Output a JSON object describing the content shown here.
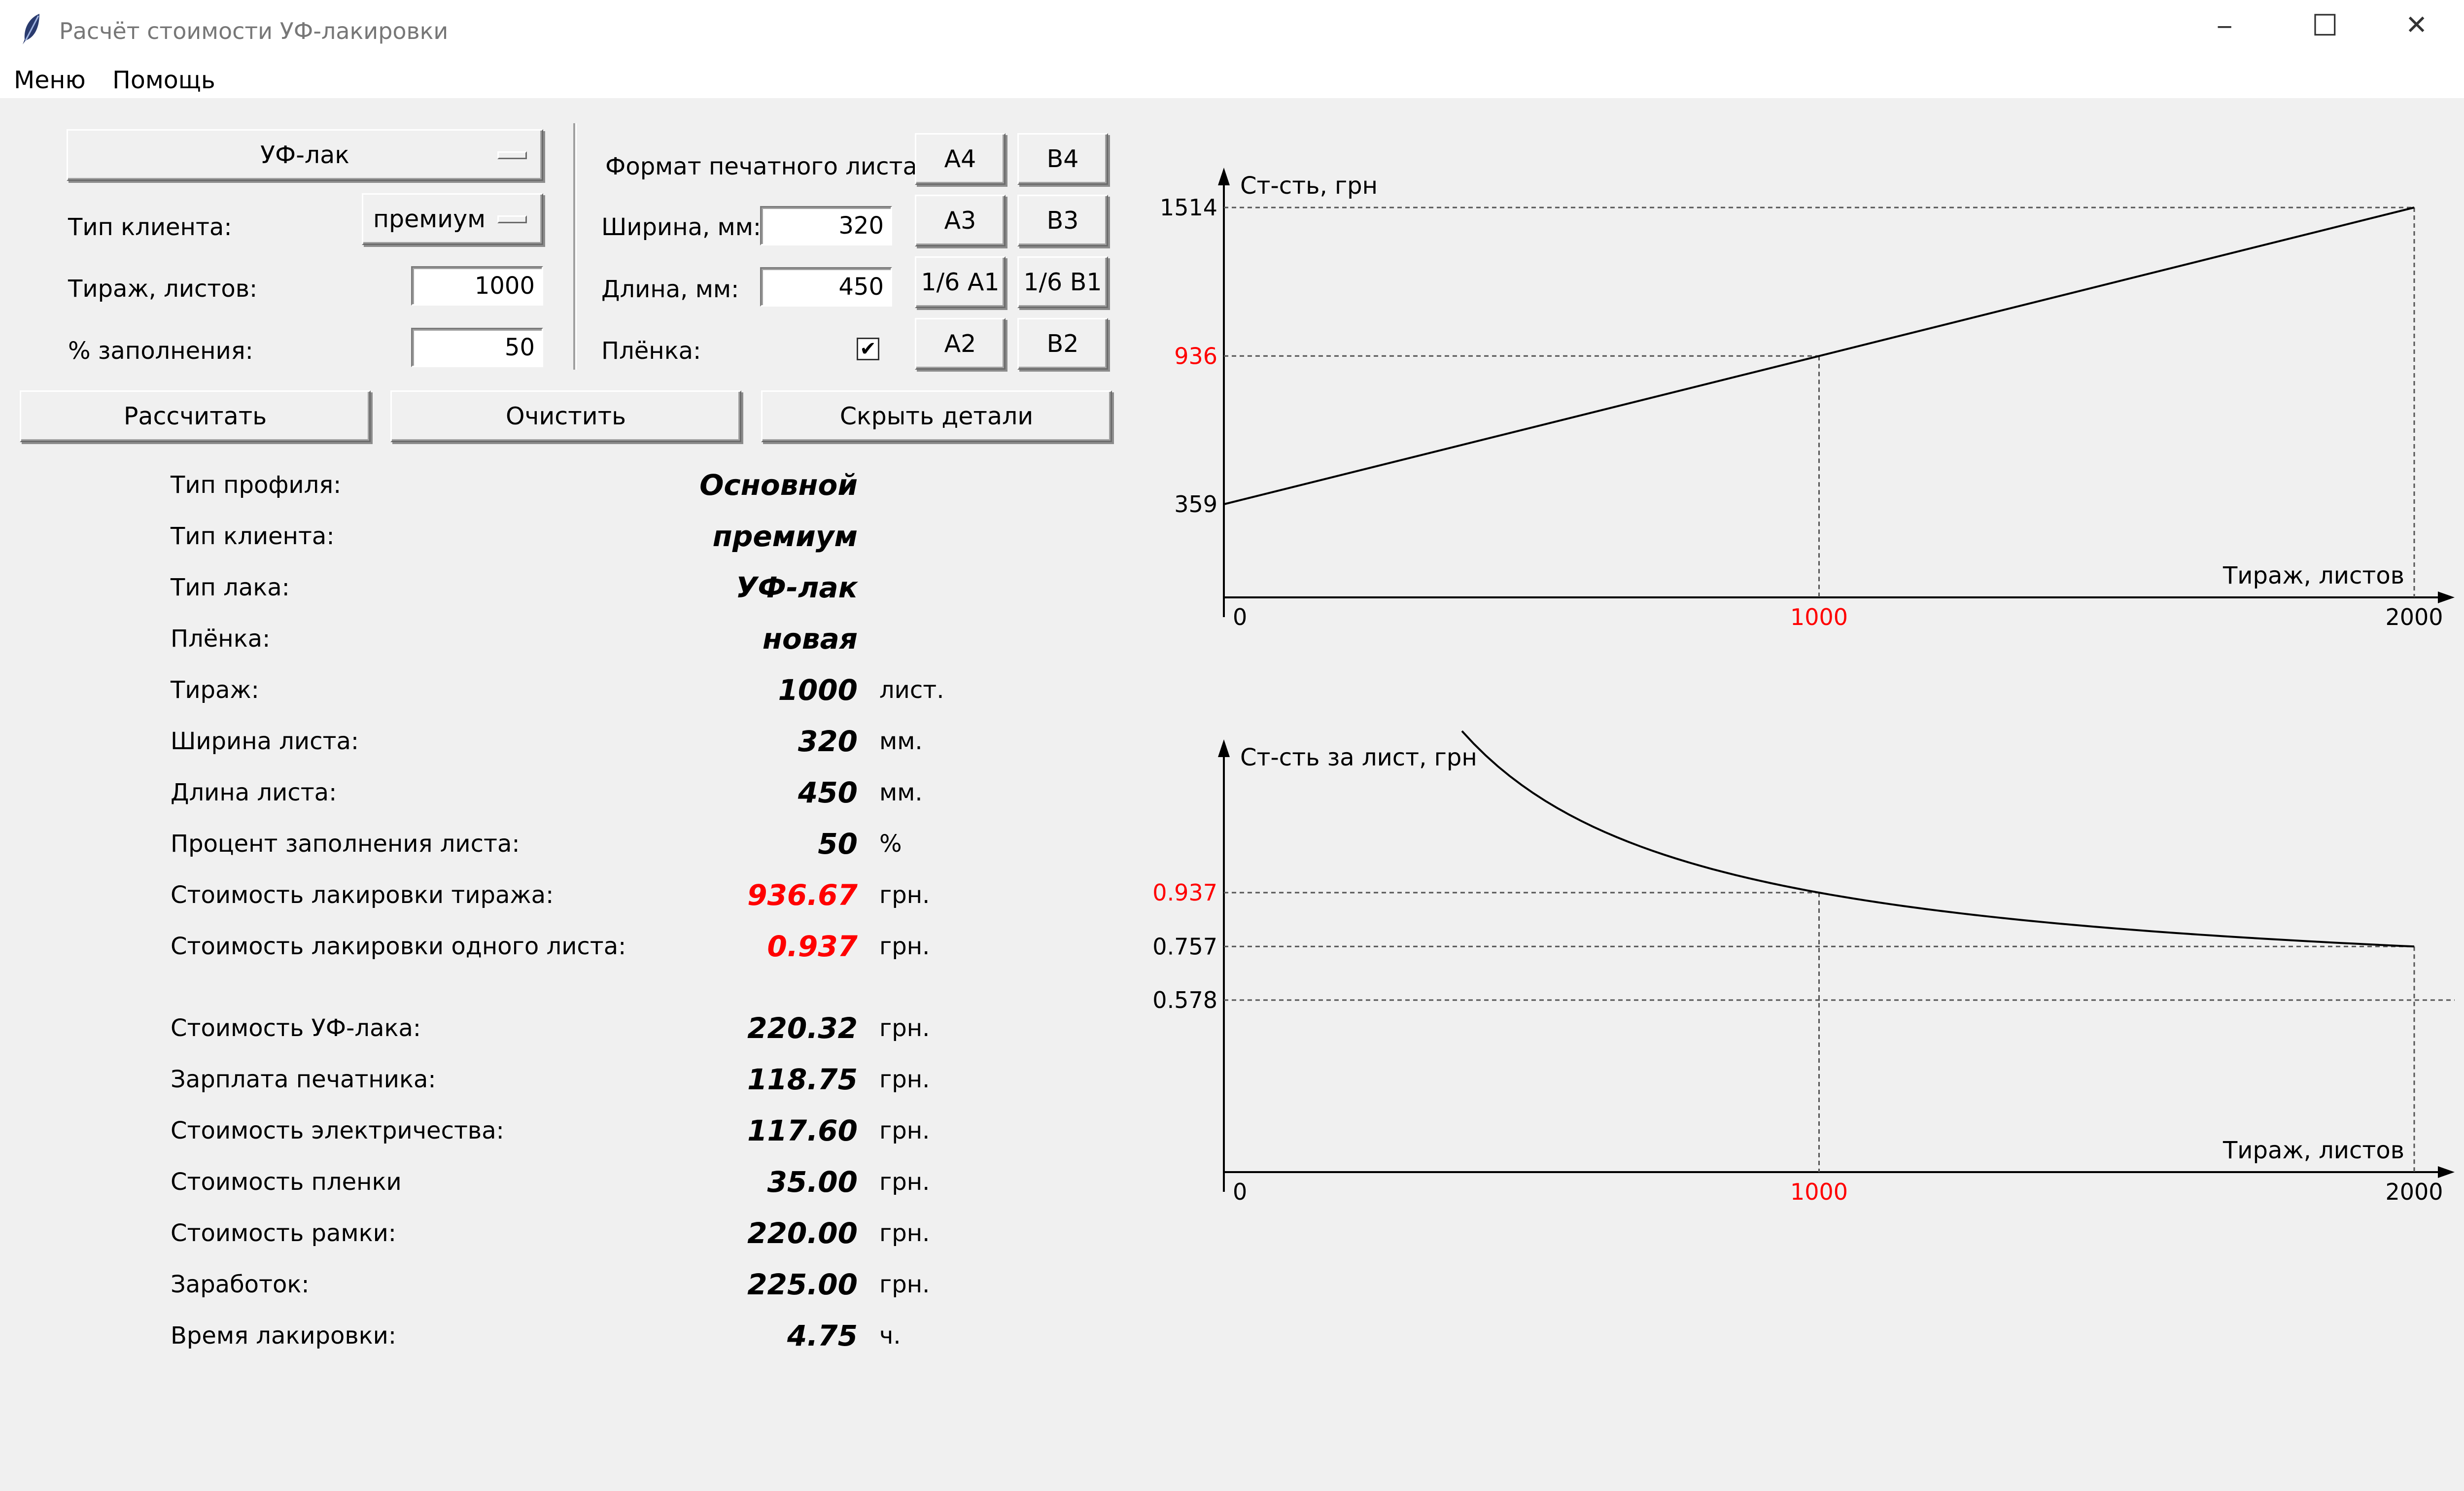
{
  "window": {
    "title": "Расчёт стоимости УФ-лакировки",
    "minimize_glyph": "─",
    "maximize_glyph": "☐",
    "close_glyph": "✕",
    "app_icon": "feather-icon"
  },
  "menu": {
    "items": [
      "Меню",
      "Помощь"
    ]
  },
  "controls": {
    "lacquer_type": "УФ-лак",
    "client_type_label": "Тип клиента:",
    "client_type": "премиум",
    "run_label": "Тираж, листов:",
    "run_value": "1000",
    "fill_label": "% заполнения:",
    "fill_value": "50",
    "sheet_format_label": "Формат печатного листа",
    "width_label": "Ширина, мм:",
    "width_value": "320",
    "length_label": "Длина, мм:",
    "length_value": "450",
    "film_label": "Плёнка:",
    "film_checked": true,
    "format_buttons": [
      "A4",
      "B4",
      "A3",
      "B3",
      "1/6 A1",
      "1/6 B1",
      "A2",
      "B2"
    ],
    "calculate": "Рассчитать",
    "clear": "Очистить",
    "hide_details": "Скрыть детали"
  },
  "results": [
    {
      "label": "Тип профиля:",
      "value": "Основной",
      "unit": "",
      "highlight": false
    },
    {
      "label": "Тип клиента:",
      "value": "премиум",
      "unit": "",
      "highlight": false
    },
    {
      "label": "Тип лака:",
      "value": "УФ-лак",
      "unit": "",
      "highlight": false
    },
    {
      "label": "Плёнка:",
      "value": "новая",
      "unit": "",
      "highlight": false
    },
    {
      "label": "Тираж:",
      "value": "1000",
      "unit": "лист.",
      "highlight": false
    },
    {
      "label": "Ширина листа:",
      "value": "320",
      "unit": "мм.",
      "highlight": false
    },
    {
      "label": "Длина листа:",
      "value": "450",
      "unit": "мм.",
      "highlight": false
    },
    {
      "label": "Процент заполнения листа:",
      "value": "50",
      "unit": "%",
      "highlight": false
    },
    {
      "label": "Стоимость лакировки тиража:",
      "value": "936.67",
      "unit": "грн.",
      "highlight": true
    },
    {
      "label": "Стоимость лакировки одного листа:",
      "value": "0.937",
      "unit": "грн.",
      "highlight": true
    }
  ],
  "details": [
    {
      "label": "Стоимость УФ-лака:",
      "value": "220.32",
      "unit": "грн."
    },
    {
      "label": "Зарплата печатника:",
      "value": "118.75",
      "unit": "грн."
    },
    {
      "label": "Стоимость электричества:",
      "value": "117.60",
      "unit": "грн."
    },
    {
      "label": "Стоимость пленки",
      "value": "35.00",
      "unit": "грн."
    },
    {
      "label": "Стоимость рамки:",
      "value": "220.00",
      "unit": "грн."
    },
    {
      "label": "Заработок:",
      "value": "225.00",
      "unit": "грн."
    },
    {
      "label": "Время лакировки:",
      "value": "4.75",
      "unit": "ч."
    }
  ],
  "colors": {
    "highlight": "#ff0000",
    "window_bg": "#f0f0f0"
  },
  "chart_data": [
    {
      "type": "line",
      "ylabel": "Ст-сть, грн",
      "xlabel": "Тираж, листов",
      "x_ticks": [
        "0",
        "1000",
        "2000"
      ],
      "y_ticks": [
        "359",
        "936",
        "1514"
      ],
      "highlight_x": "1000",
      "highlight_y": "936",
      "xlim": [
        0,
        2000
      ],
      "ylim": [
        200,
        1600
      ],
      "x": [
        0,
        1000,
        2000
      ],
      "y": [
        359,
        936,
        1514
      ]
    },
    {
      "type": "line",
      "ylabel": "Ст-сть за лист, грн",
      "xlabel": "Тираж, листов",
      "x_ticks": [
        "0",
        "1000",
        "2000"
      ],
      "y_ticks": [
        "0.578",
        "0.757",
        "0.937"
      ],
      "highlight_x": "1000",
      "highlight_y": "0.937",
      "xlim": [
        0,
        2000
      ],
      "ylim": [
        0.2,
        1.3
      ],
      "x": [
        400,
        500,
        600,
        700,
        800,
        1000,
        1200,
        1400,
        1600,
        1800,
        2000
      ],
      "y": [
        1.256,
        1.1,
        0.982,
        0.9,
        0.836,
        0.937,
        0.876,
        0.834,
        0.803,
        0.778,
        0.757
      ]
    }
  ]
}
